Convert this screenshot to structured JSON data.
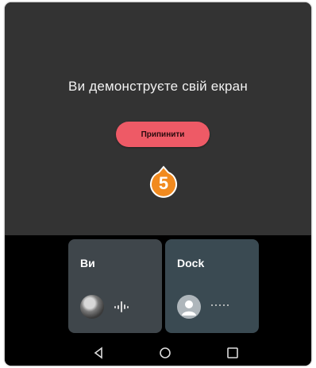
{
  "share": {
    "title": "Ви демонструєте свій екран",
    "stop_label": "Припинити"
  },
  "annotation": {
    "step": "5",
    "color": "#f18a1f"
  },
  "tiles": [
    {
      "name": "Ви",
      "avatar": "photo",
      "indicator": "audio-waveform-icon"
    },
    {
      "name": "Dock",
      "avatar": "default-person-icon",
      "indicator": "dots-icon"
    }
  ],
  "navbar": {
    "buttons": [
      "back-icon",
      "home-icon",
      "recents-icon"
    ]
  },
  "colors": {
    "panel": "#333333",
    "stop_button": "#ee5a66",
    "tile": "#3d454a",
    "badge": "#f18a1f"
  }
}
